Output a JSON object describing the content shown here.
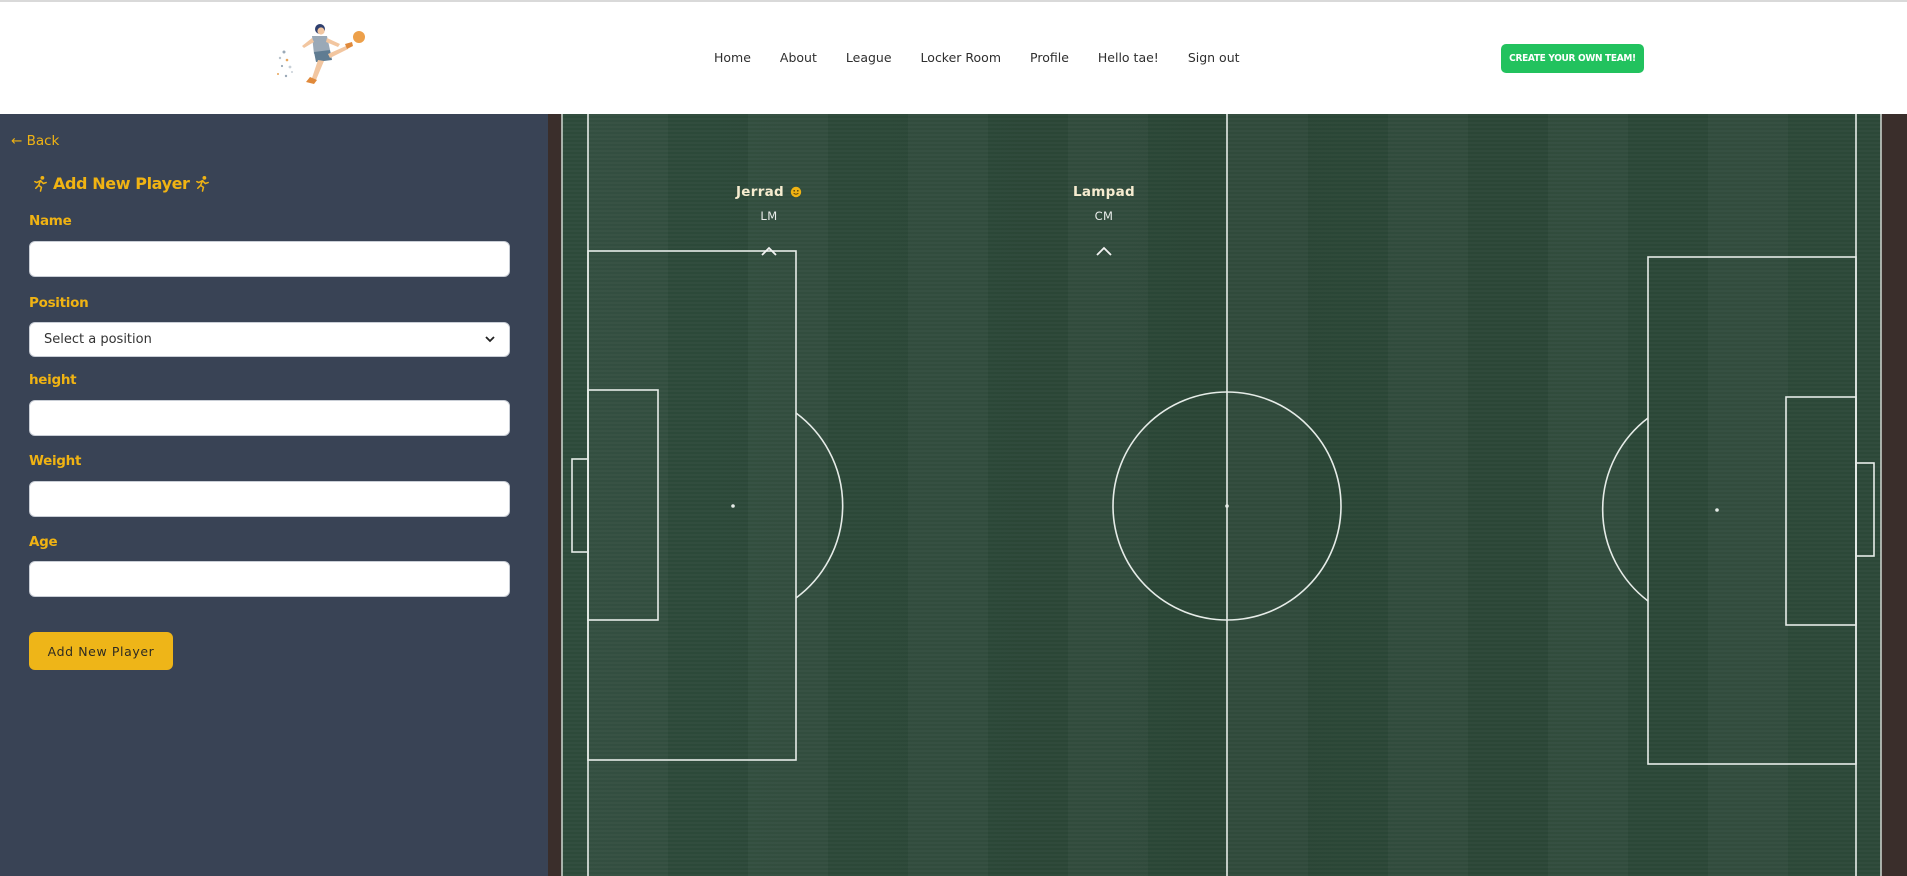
{
  "nav": {
    "links": [
      "Home",
      "About",
      "League",
      "Locker Room",
      "Profile",
      "Hello tae!",
      "Sign out"
    ],
    "cta_label": "CREATE YOUR OWN TEAM!"
  },
  "sidebar": {
    "back_label": "← Back",
    "form_title": "Add New Player",
    "fields": {
      "name_label": "Name",
      "name_value": "",
      "position_label": "Position",
      "position_selected": "Select a position",
      "height_label": "height",
      "height_value": "",
      "weight_label": "Weight",
      "weight_value": "",
      "age_label": "Age",
      "age_value": ""
    },
    "submit_label": "Add New Player"
  },
  "pitch": {
    "players": [
      {
        "name": "Jerrad",
        "position": "LM",
        "has_badge": true
      },
      {
        "name": "Lampad",
        "position": "CM",
        "has_badge": false
      }
    ]
  },
  "colors": {
    "accent": "#f0b313",
    "sidebar_bg": "#394355",
    "cta": "#22c25e",
    "pitch": "#2b4637"
  }
}
